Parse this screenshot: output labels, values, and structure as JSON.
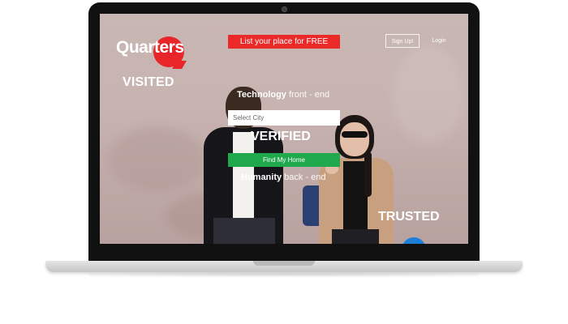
{
  "header": {
    "logo_text": "Quarters",
    "cta_label": "List your place for FREE",
    "signup_label": "Sign Up!",
    "login_label": "Login"
  },
  "hero": {
    "word_visited": "VISITED",
    "word_verified": "VERIFIED",
    "word_trusted": "TRUSTED",
    "tagline_1_bold": "Technology",
    "tagline_1_rest": " front - end",
    "tagline_2_bold": "Humanity",
    "tagline_2_rest": " back - end"
  },
  "search": {
    "city_placeholder": "Select City",
    "find_label": "Find My Home"
  },
  "colors": {
    "accent_red": "#ec2929",
    "action_green": "#1fa84c",
    "chat_blue": "#1e7fd8"
  },
  "icons": {
    "chat": "chat-bubble-icon",
    "camera": "webcam-icon"
  }
}
